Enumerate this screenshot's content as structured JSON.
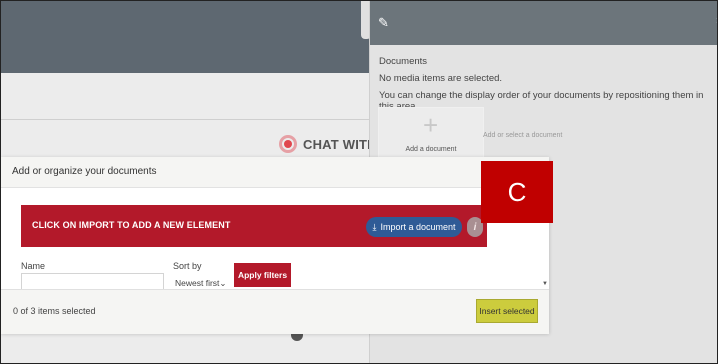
{
  "background": {
    "chat_label": "CHAT WITH TE"
  },
  "panel": {
    "heading": "Documents",
    "no_items": "No media items are selected.",
    "reorder_hint": "You can change the display order of your documents by repositioning them in this area.",
    "add_document_label": "Add a document",
    "add_or_select_hint": "Add or select a document",
    "close_glyph": "×",
    "edit_glyph": "✎"
  },
  "modal": {
    "title": "Add or organize your documents",
    "banner_text": "CLICK ON IMPORT TO ADD A NEW ELEMENT",
    "import_button": "Import a document",
    "import_icon_glyph": "⤓",
    "info_glyph": "i",
    "name_label": "Name",
    "name_value": "",
    "sort_label": "Sort by",
    "sort_value": "Newest first",
    "apply_button": "Apply filters",
    "selection_status": "0 of 3 items selected",
    "insert_button": "Insert selected"
  },
  "annotation": {
    "letter": "C",
    "color": "#c00000"
  },
  "colors": {
    "brand_red": "#b3192a",
    "import_blue": "#2f5b96",
    "insert_yellow": "#cccc3d",
    "header_gray": "#5e6871"
  }
}
